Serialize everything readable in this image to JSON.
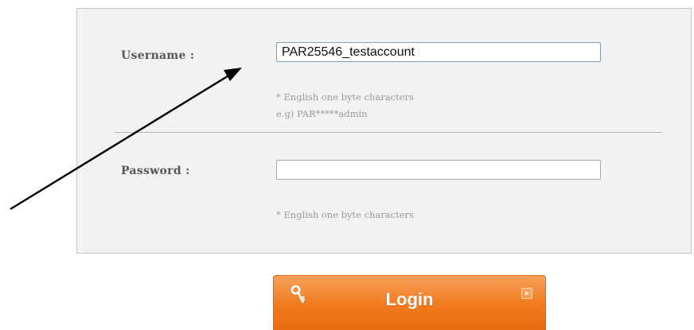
{
  "form": {
    "username": {
      "label": "Username :",
      "value": "PAR25546_testaccount",
      "hint_line1": "* English one byte characters",
      "hint_line2": "e.g) PAR*****admin"
    },
    "password": {
      "label": "Password :",
      "value": "",
      "hint_line1": "* English one byte characters"
    },
    "login_button": {
      "label": "Login",
      "left_icon": "key-icon",
      "right_icon": "arrow-right-icon"
    }
  },
  "colors": {
    "panel_background": "#f2f2f2",
    "panel_border": "#c6c6c6",
    "button_orange": "#f07a1c",
    "hint_text": "#9a9a9a"
  },
  "annotation": {
    "type": "arrow",
    "points_to": "username-input"
  }
}
